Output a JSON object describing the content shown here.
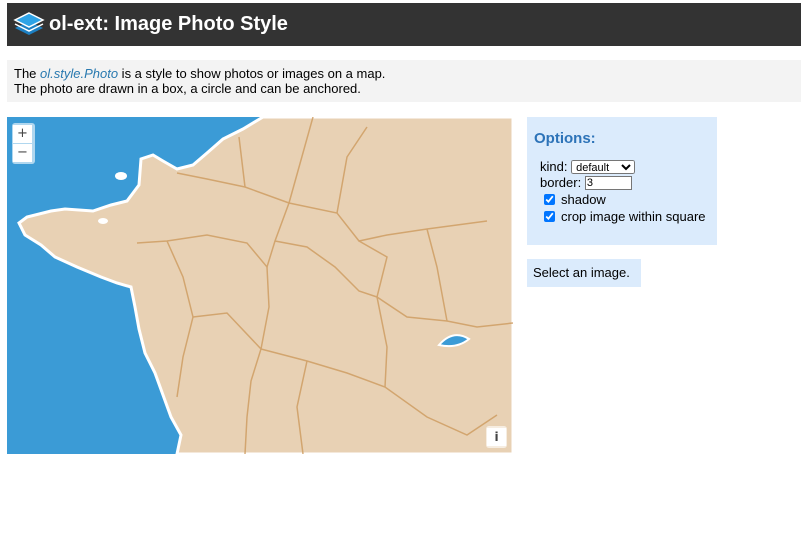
{
  "header": {
    "title": "ol-ext: Image Photo Style",
    "logo_icon": "layers-icon",
    "colors": {
      "bar": "#333333",
      "logo": "#2ea3e6"
    }
  },
  "info": {
    "line1_prefix": "The ",
    "line1_link": "ol.style.Photo",
    "line1_suffix": " is a style to show photos or images on a map.",
    "line2": "The photo are drawn in a box, a circle and can be anchored."
  },
  "map": {
    "zoom_in": "+",
    "zoom_out": "−",
    "attribution": "i",
    "colors": {
      "sea": "#3b9bd6",
      "land": "#e8d1b4",
      "borders": "#cf9e63"
    }
  },
  "options": {
    "title": "Options:",
    "kind_label": "kind:",
    "kind_value": "default",
    "border_label": "border:",
    "border_value": "3",
    "shadow_label": "shadow",
    "shadow_checked": true,
    "crop_label": "crop image within square",
    "crop_checked": true
  },
  "status": {
    "text": "Select an image."
  }
}
